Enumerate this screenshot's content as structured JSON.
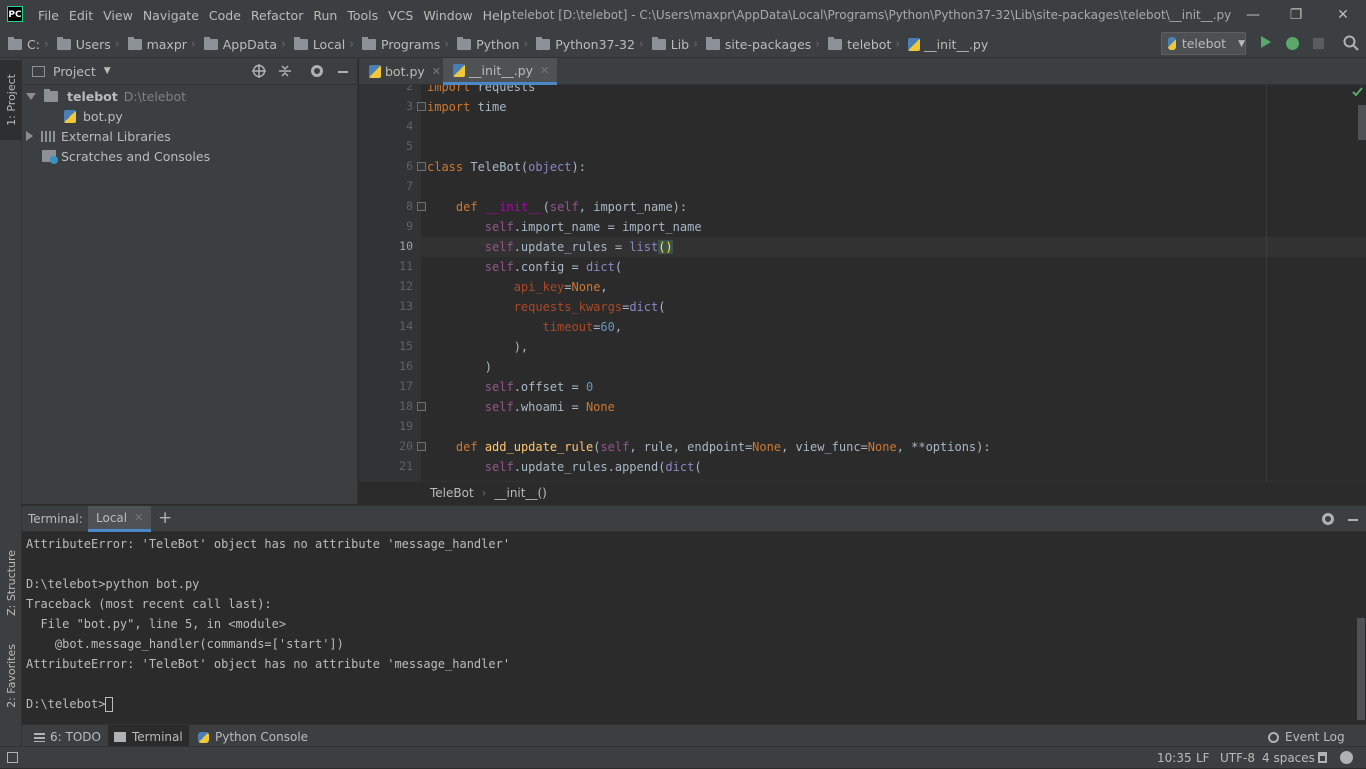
{
  "app": {
    "logo_text": "PC"
  },
  "menu": [
    "File",
    "Edit",
    "View",
    "Navigate",
    "Code",
    "Refactor",
    "Run",
    "Tools",
    "VCS",
    "Window",
    "Help"
  ],
  "window_title": "telebot [D:\\telebot] - C:\\Users\\maxpr\\AppData\\Local\\Programs\\Python\\Python37-32\\Lib\\site-packages\\telebot\\__init__.py",
  "window_controls": {
    "minimize": "—",
    "maximize": "❐",
    "close": "✕"
  },
  "breadcrumbs": [
    "C:",
    "Users",
    "maxpr",
    "AppData",
    "Local",
    "Programs",
    "Python",
    "Python37-32",
    "Lib",
    "site-packages",
    "telebot",
    "__init__.py"
  ],
  "run_config": {
    "name": "telebot"
  },
  "left_strip": {
    "project": "1: Project",
    "structure": "Z: Structure",
    "favorites": "2: Favorites"
  },
  "project_panel": {
    "title": "Project",
    "tree": [
      {
        "label": "telebot",
        "hint": "D:\\telebot"
      },
      {
        "label": "bot.py"
      },
      {
        "label": "External Libraries"
      },
      {
        "label": "Scratches and Consoles"
      }
    ]
  },
  "editor_tabs": [
    {
      "label": "bot.py",
      "close": "✕"
    },
    {
      "label": "__init__.py",
      "close": "✕"
    }
  ],
  "editor": {
    "line_numbers": [
      "2",
      "3",
      "4",
      "5",
      "6",
      "7",
      "8",
      "9",
      "10",
      "11",
      "12",
      "13",
      "14",
      "15",
      "16",
      "17",
      "18",
      "19",
      "20",
      "21"
    ],
    "current_line": "10"
  },
  "code_breadcrumb": {
    "class": "TeleBot",
    "method": "__init__()"
  },
  "terminal": {
    "label": "Terminal:",
    "tab": "Local",
    "tab_close": "✕",
    "add": "+",
    "lines": [
      "AttributeError: 'TeleBot' object has no attribute 'message_handler'",
      "",
      "D:\\telebot>python bot.py",
      "Traceback (most recent call last):",
      "  File \"bot.py\", line 5, in <module>",
      "    @bot.message_handler(commands=['start'])",
      "AttributeError: 'TeleBot' object has no attribute 'message_handler'",
      "",
      "D:\\telebot>"
    ]
  },
  "bottom_tabs": {
    "todo": "6: TODO",
    "terminal": "Terminal",
    "python_console": "Python Console",
    "event_log": "Event Log"
  },
  "status": {
    "position": "10:35",
    "line_sep": "LF",
    "encoding": "UTF-8",
    "indent": "4 spaces"
  }
}
